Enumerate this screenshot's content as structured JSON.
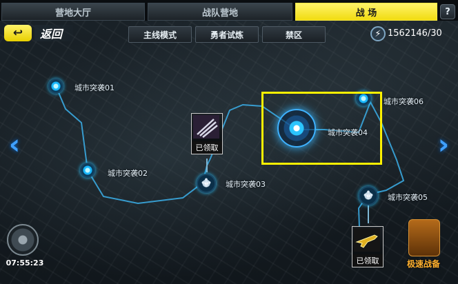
{
  "tabs": [
    {
      "label": "营地大厅",
      "active": false
    },
    {
      "label": "战队营地",
      "active": false
    },
    {
      "label": "战 场",
      "active": true
    }
  ],
  "help_label": "?",
  "toolbar": {
    "back_label": "返回",
    "back_icon": "↩",
    "modes": [
      "主线模式",
      "勇者试炼",
      "禁区"
    ],
    "energy_icon": "lightning-icon",
    "energy_value": "1562146/30"
  },
  "stages": [
    {
      "label": "城市突袭01",
      "type": "normal"
    },
    {
      "label": "城市突袭02",
      "type": "normal"
    },
    {
      "label": "城市突袭03",
      "type": "boss"
    },
    {
      "label": "城市突袭04",
      "type": "current"
    },
    {
      "label": "城市突袭05",
      "type": "boss"
    },
    {
      "label": "城市突袭06",
      "type": "normal"
    }
  ],
  "rewards": [
    {
      "status": "已领取",
      "icon": "claw-icon"
    },
    {
      "status": "已领取",
      "icon": "gold-rifle-icon"
    }
  ],
  "timer": "07:55:23",
  "quick_prepare": "极速战备",
  "nav": {
    "left": "‹",
    "right": "›"
  },
  "colors": {
    "accent": "#f1dc10",
    "path": "#3aa8e0",
    "highlight": "#fff100",
    "quick": "#ffb02e"
  }
}
